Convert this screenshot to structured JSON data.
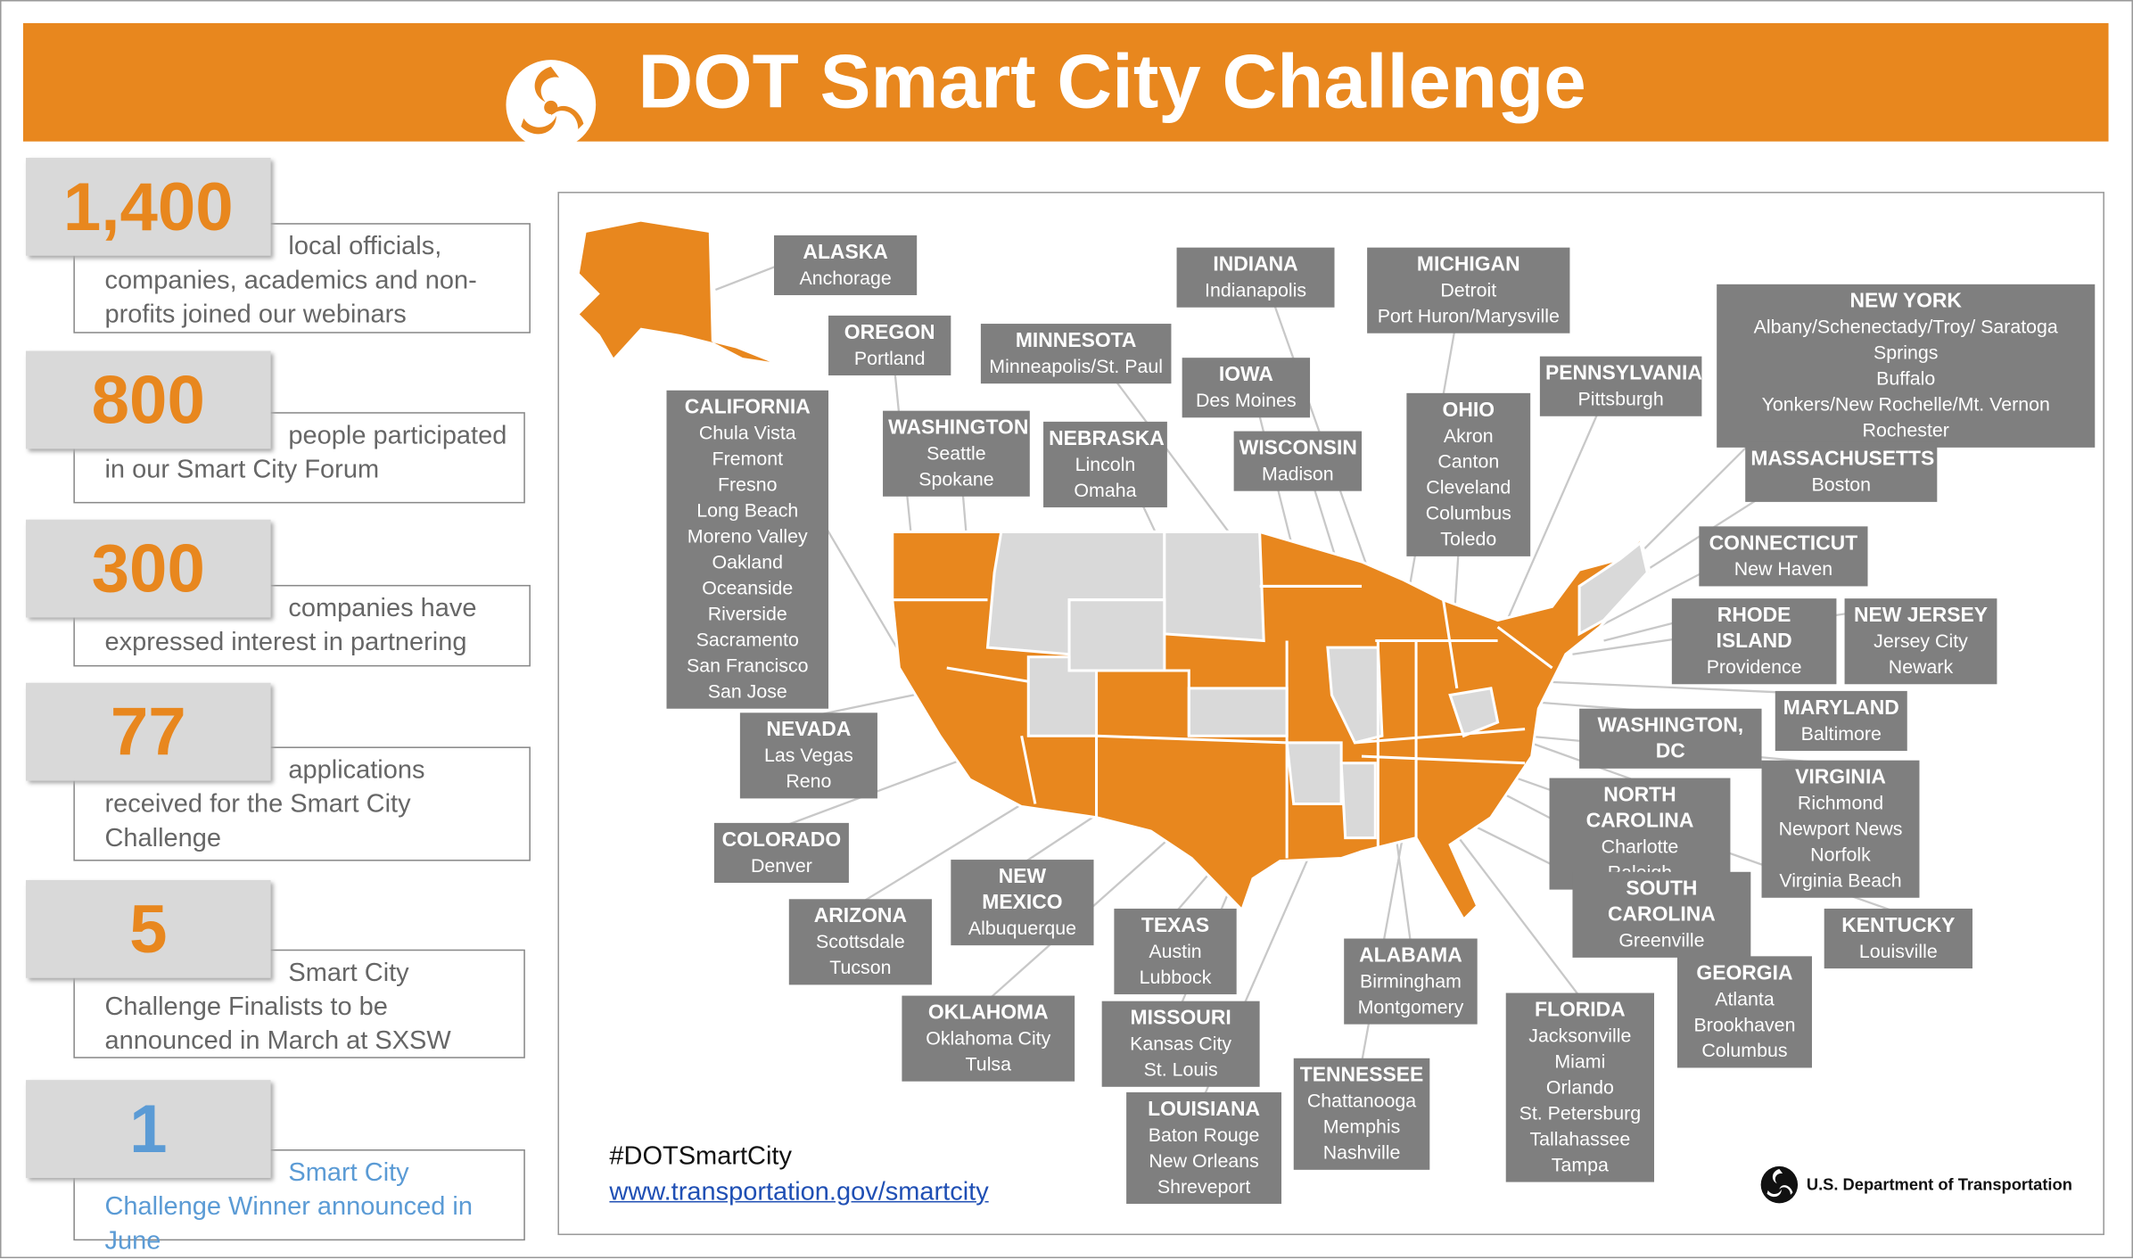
{
  "header": {
    "title": "DOT Smart City Challenge",
    "logo_icon": "dot-triskelion-logo"
  },
  "colors": {
    "orange": "#E8871E",
    "gray_label": "#7F7F7F",
    "blue": "#5B9BD5",
    "inactive_state": "#D9D9D9"
  },
  "stats": [
    {
      "number": "1,400",
      "first": "local officials,",
      "rest": "companies, academics and non-profits joined our webinars"
    },
    {
      "number": "800",
      "first": "people participated",
      "rest": "in our Smart City Forum"
    },
    {
      "number": "300",
      "first": "companies have",
      "rest": "expressed interest in partnering"
    },
    {
      "number": "77",
      "first": "applications",
      "rest": "received for the Smart City Challenge"
    },
    {
      "number": "5",
      "first": "Smart City",
      "rest": "Challenge Finalists to be announced in March at SXSW"
    },
    {
      "number": "1",
      "first": "Smart City",
      "rest": "Challenge Winner announced in June"
    }
  ],
  "states": [
    {
      "name": "ALASKA",
      "cities": [
        "Anchorage"
      ]
    },
    {
      "name": "OREGON",
      "cities": [
        "Portland"
      ]
    },
    {
      "name": "CALIFORNIA",
      "cities": [
        "Chula Vista",
        "Fremont",
        "Fresno",
        "Long Beach",
        "Moreno Valley",
        "Oakland",
        "Oceanside",
        "Riverside",
        "Sacramento",
        "San Francisco",
        "San Jose"
      ]
    },
    {
      "name": "WASHINGTON",
      "cities": [
        "Seattle",
        "Spokane"
      ]
    },
    {
      "name": "MINNESOTA",
      "cities": [
        "Minneapolis/St. Paul"
      ]
    },
    {
      "name": "NEBRASKA",
      "cities": [
        "Lincoln",
        "Omaha"
      ]
    },
    {
      "name": "INDIANA",
      "cities": [
        "Indianapolis"
      ]
    },
    {
      "name": "IOWA",
      "cities": [
        "Des Moines"
      ]
    },
    {
      "name": "WISCONSIN",
      "cities": [
        "Madison"
      ]
    },
    {
      "name": "MICHIGAN",
      "cities": [
        "Detroit",
        "Port Huron/Marysville"
      ]
    },
    {
      "name": "PENNSYLVANIA",
      "cities": [
        "Pittsburgh"
      ]
    },
    {
      "name": "OHIO",
      "cities": [
        "Akron",
        "Canton",
        "Cleveland",
        "Columbus",
        "Toledo"
      ]
    },
    {
      "name": "NEW YORK",
      "cities": [
        "Albany/Schenectady/Troy/ Saratoga Springs",
        "Buffalo",
        "Yonkers/New Rochelle/Mt. Vernon",
        "Rochester"
      ]
    },
    {
      "name": "MASSACHUSETTS",
      "cities": [
        "Boston"
      ]
    },
    {
      "name": "CONNECTICUT",
      "cities": [
        "New Haven"
      ]
    },
    {
      "name": "RHODE ISLAND",
      "cities": [
        "Providence"
      ]
    },
    {
      "name": "NEW JERSEY",
      "cities": [
        "Jersey City",
        "Newark"
      ]
    },
    {
      "name": "WASHINGTON, DC",
      "cities": []
    },
    {
      "name": "MARYLAND",
      "cities": [
        "Baltimore"
      ]
    },
    {
      "name": "NORTH CAROLINA",
      "cities": [
        "Charlotte",
        "Raleigh"
      ]
    },
    {
      "name": "VIRGINIA",
      "cities": [
        "Richmond",
        "Newport News",
        "Norfolk",
        "Virginia Beach"
      ]
    },
    {
      "name": "SOUTH CAROLINA",
      "cities": [
        "Greenville"
      ]
    },
    {
      "name": "KENTUCKY",
      "cities": [
        "Louisville"
      ]
    },
    {
      "name": "GEORGIA",
      "cities": [
        "Atlanta",
        "Brookhaven",
        "Columbus"
      ]
    },
    {
      "name": "FLORIDA",
      "cities": [
        "Jacksonville",
        "Miami",
        "Orlando",
        "St. Petersburg",
        "Tallahassee",
        "Tampa"
      ]
    },
    {
      "name": "TENNESSEE",
      "cities": [
        "Chattanooga",
        "Memphis",
        "Nashville"
      ]
    },
    {
      "name": "ALABAMA",
      "cities": [
        "Birmingham",
        "Montgomery"
      ]
    },
    {
      "name": "LOUISIANA",
      "cities": [
        "Baton Rouge",
        "New Orleans",
        "Shreveport"
      ]
    },
    {
      "name": "MISSOURI",
      "cities": [
        "Kansas City",
        "St. Louis"
      ]
    },
    {
      "name": "TEXAS",
      "cities": [
        "Austin",
        "Lubbock"
      ]
    },
    {
      "name": "OKLAHOMA",
      "cities": [
        "Oklahoma City",
        "Tulsa"
      ]
    },
    {
      "name": "ARIZONA",
      "cities": [
        "Scottsdale",
        "Tucson"
      ]
    },
    {
      "name": "NEW MEXICO",
      "cities": [
        "Albuquerque"
      ]
    },
    {
      "name": "COLORADO",
      "cities": [
        "Denver"
      ]
    },
    {
      "name": "NEVADA",
      "cities": [
        "Las Vegas",
        "Reno"
      ]
    }
  ],
  "footer": {
    "hashtag": "#DOTSmartCity",
    "link": "www.transportation.gov/smartcity",
    "agency": "U.S. Department of Transportation"
  }
}
